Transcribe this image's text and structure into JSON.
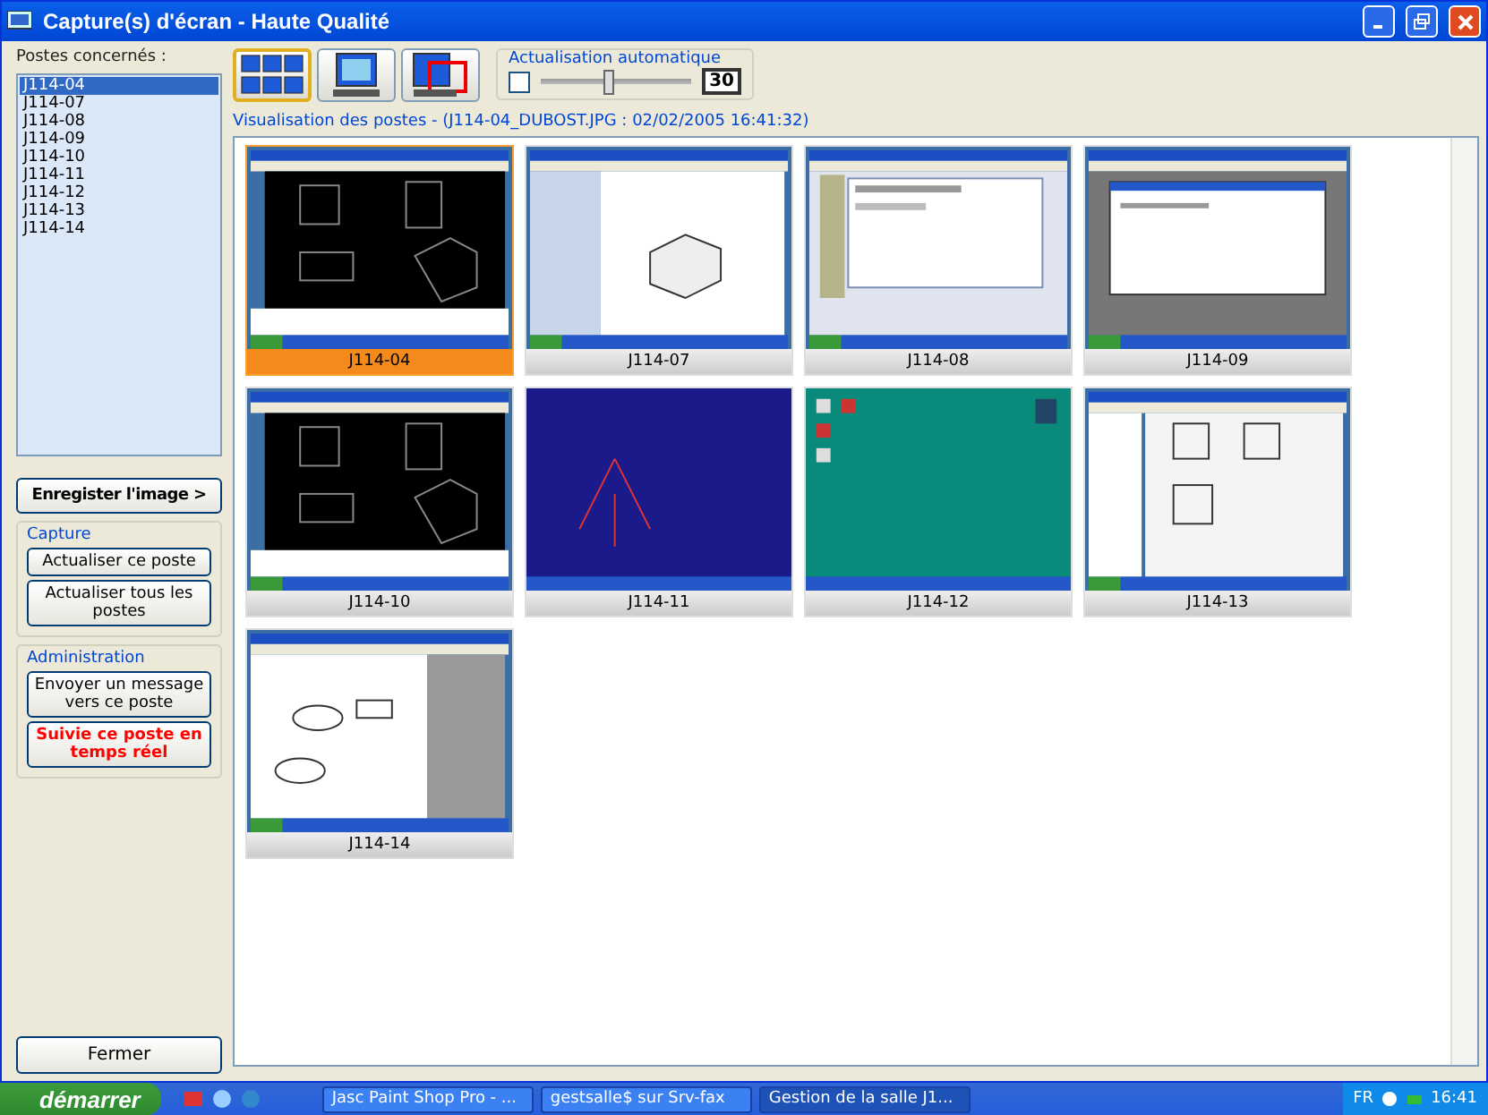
{
  "window": {
    "title": "Capture(s) d'écran - Haute Qualité"
  },
  "sidebar": {
    "label": "Postes concernés :",
    "items": [
      {
        "label": "J114-04",
        "selected": true
      },
      {
        "label": "J114-07",
        "selected": false
      },
      {
        "label": "J114-08",
        "selected": false
      },
      {
        "label": "J114-09",
        "selected": false
      },
      {
        "label": "J114-10",
        "selected": false
      },
      {
        "label": "J114-11",
        "selected": false
      },
      {
        "label": "J114-12",
        "selected": false
      },
      {
        "label": "J114-13",
        "selected": false
      },
      {
        "label": "J114-14",
        "selected": false
      }
    ],
    "save_button": "Enregister l'image >",
    "groups": [
      {
        "title": "Capture",
        "buttons": [
          {
            "label": "Actualiser ce poste",
            "kind": "normal"
          },
          {
            "label": "Actualiser tous les postes",
            "kind": "normal"
          }
        ]
      },
      {
        "title": "Administration",
        "buttons": [
          {
            "label": "Envoyer un message vers ce poste",
            "kind": "normal"
          },
          {
            "label": "Suivie ce poste en temps réel",
            "kind": "alert"
          }
        ]
      }
    ],
    "close_button": "Fermer"
  },
  "toolbar": {
    "views": [
      {
        "kind": "grid",
        "selected": true
      },
      {
        "kind": "single",
        "selected": false
      },
      {
        "kind": "remote",
        "selected": false
      }
    ],
    "auto_refresh": {
      "title": "Actualisation automatique",
      "checked": false,
      "level": 0.45,
      "value": "30"
    }
  },
  "viewer": {
    "caption": "Visualisation des postes - (J114-04_DUBOST.JPG : 02/02/2005 16:41:32)",
    "thumbnails": [
      {
        "label": "J114-04",
        "kind": "cad",
        "selected": true
      },
      {
        "label": "J114-07",
        "kind": "model",
        "selected": false
      },
      {
        "label": "J114-08",
        "kind": "form",
        "selected": false
      },
      {
        "label": "J114-09",
        "kind": "dialog",
        "selected": false
      },
      {
        "label": "J114-10",
        "kind": "cad",
        "selected": false
      },
      {
        "label": "J114-11",
        "kind": "blueprint",
        "selected": false
      },
      {
        "label": "J114-12",
        "kind": "desktop",
        "selected": false
      },
      {
        "label": "J114-13",
        "kind": "sheet",
        "selected": false
      },
      {
        "label": "J114-14",
        "kind": "diagram",
        "selected": false
      }
    ]
  },
  "taskbar": {
    "start": "démarrer",
    "tasks": [
      {
        "label": "Jasc Paint Shop Pro - ...",
        "selected": false
      },
      {
        "label": "gestsalle$ sur Srv-fax",
        "selected": false
      },
      {
        "label": "Gestion de la salle J1...",
        "selected": true
      }
    ],
    "language": "FR",
    "clock": "16:41"
  }
}
